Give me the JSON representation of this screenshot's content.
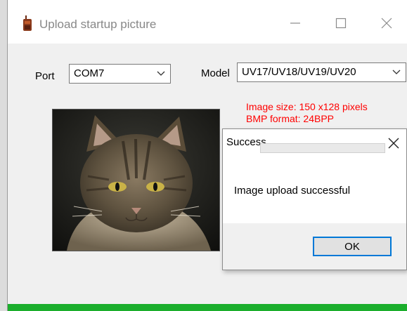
{
  "window": {
    "title": "Upload startup picture",
    "controls": {
      "minimize": "minimize-icon",
      "maximize": "maximize-icon",
      "close": "close-icon"
    }
  },
  "form": {
    "port_label": "Port",
    "port_value": "COM7",
    "model_label": "Model",
    "model_value": "UV17/UV18/UV19/UV20"
  },
  "info": {
    "image_size": "Image size: 150 x128 pixels",
    "bmp_format": "BMP format: 24BPP"
  },
  "preview": {
    "subject": "tabby cat photo"
  },
  "progress": {
    "fraction": 1.0,
    "color": "#1bae2c"
  },
  "dialog": {
    "title": "Success",
    "message": "Image upload successful",
    "ok_label": "OK"
  },
  "colors": {
    "info_text": "#ff0000",
    "focus_border": "#0078d7"
  }
}
